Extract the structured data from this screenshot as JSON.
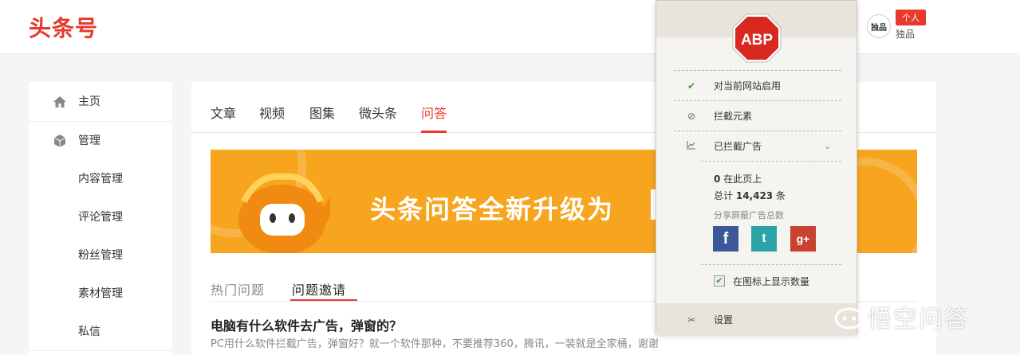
{
  "header": {
    "logo": "头条号",
    "avatar_text": "独品",
    "user_badge": "个人",
    "user_name": "独品"
  },
  "sidebar": {
    "items": [
      {
        "label": "主页",
        "icon": "home-icon"
      },
      {
        "label": "管理",
        "icon": "cube-icon"
      },
      {
        "label": "内容管理"
      },
      {
        "label": "评论管理"
      },
      {
        "label": "粉丝管理"
      },
      {
        "label": "素材管理"
      },
      {
        "label": "私信"
      }
    ]
  },
  "main": {
    "tabs": [
      {
        "label": "文章"
      },
      {
        "label": "视频"
      },
      {
        "label": "图集"
      },
      {
        "label": "微头条"
      },
      {
        "label": "问答"
      }
    ],
    "active_tab": "问答",
    "banner_text": "头条问答全新升级为",
    "subtabs": [
      {
        "label": "热门问题"
      },
      {
        "label": "问题邀请"
      }
    ],
    "active_subtab": "问题邀请",
    "question": {
      "title": "电脑有什么软件去广告，弹窗的？",
      "description": "PC用什么软件拦截广告，弹窗好？就一个软件那种，不要推荐360，腾讯，一装就是全家桶，谢谢"
    }
  },
  "abp_popup": {
    "logo_text": "ABP",
    "enable_label": "对当前网站启用",
    "block_element_label": "拦截元素",
    "blocked_ads_label": "已拦截广告",
    "stat_page_count": "0",
    "stat_page_label": "在此页上",
    "stat_total_prefix": "总计",
    "stat_total_count": "14,423",
    "stat_total_suffix": "条",
    "share_label": "分享屏蔽广告总数",
    "facebook": "f",
    "twitter": "t",
    "googleplus": "g+",
    "show_count_label": "在图标上显示数量",
    "show_count_checked": true,
    "settings_label": "设置"
  },
  "watermark": {
    "text": "悟空问答"
  },
  "colors": {
    "brand_red": "#e8392d",
    "banner_orange": "#f7a51f",
    "abp_red": "#d8281f",
    "facebook": "#3b5998",
    "twitter": "#2aa3a8",
    "googleplus": "#c9412f"
  }
}
